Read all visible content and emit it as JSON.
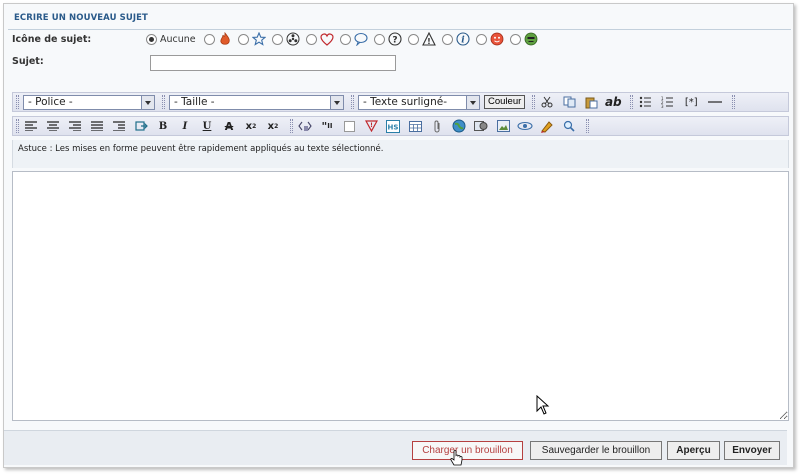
{
  "header": {
    "title": "ECRIRE UN NOUVEAU SUJET"
  },
  "form": {
    "icon_label": "Icône de sujet:",
    "subject_label": "Sujet:",
    "subject_value": "",
    "icons": [
      {
        "label": "Aucune",
        "checked": true,
        "icon": "none"
      },
      {
        "icon": "flame-icon"
      },
      {
        "icon": "star-icon"
      },
      {
        "icon": "radiation-icon"
      },
      {
        "icon": "heart-icon"
      },
      {
        "icon": "speech-bubble-icon"
      },
      {
        "icon": "question-icon"
      },
      {
        "icon": "warning-icon"
      },
      {
        "icon": "info-icon"
      },
      {
        "icon": "smiley-icon"
      },
      {
        "icon": "alien-icon"
      }
    ]
  },
  "toolbar1": {
    "font_select": "- Police -",
    "size_select": "- Taille -",
    "highlight_select": "- Texte surligné-",
    "color_button": "Couleur",
    "icons": [
      "cut-icon",
      "copy-icon",
      "paste-icon",
      "spellcheck-icon",
      "bullet-list-icon",
      "numbered-list-icon",
      "list-item-icon",
      "horizontal-rule-icon"
    ],
    "list_item_text": "[*]"
  },
  "toolbar2": {
    "icons": [
      "align-left-icon",
      "align-center-icon",
      "align-right-icon",
      "justify-icon",
      "indent-icon",
      "link-out-icon",
      "bold-icon",
      "italic-icon",
      "underline-icon",
      "strikethrough-icon",
      "superscript-icon",
      "subscript-icon",
      "code-icon",
      "quote-icon",
      "blank-icon",
      "spoiler-icon",
      "hidden-icon",
      "table-icon",
      "attachment-icon",
      "globe-icon",
      "media-icon",
      "image-icon",
      "flash-icon",
      "marker-icon",
      "search-icon"
    ]
  },
  "tip": {
    "text": "Astuce : Les mises en forme peuvent être rapidement appliqués au texte sélectionné."
  },
  "footer": {
    "load_draft": "Charger un brouillon",
    "save_draft": "Sauvegarder le brouillon",
    "preview": "Aperçu",
    "send": "Envoyer"
  },
  "colors": {
    "header_text": "#2a5a8a",
    "draft_border": "#b54040",
    "toolbar_bg": "#e6e8f2"
  }
}
